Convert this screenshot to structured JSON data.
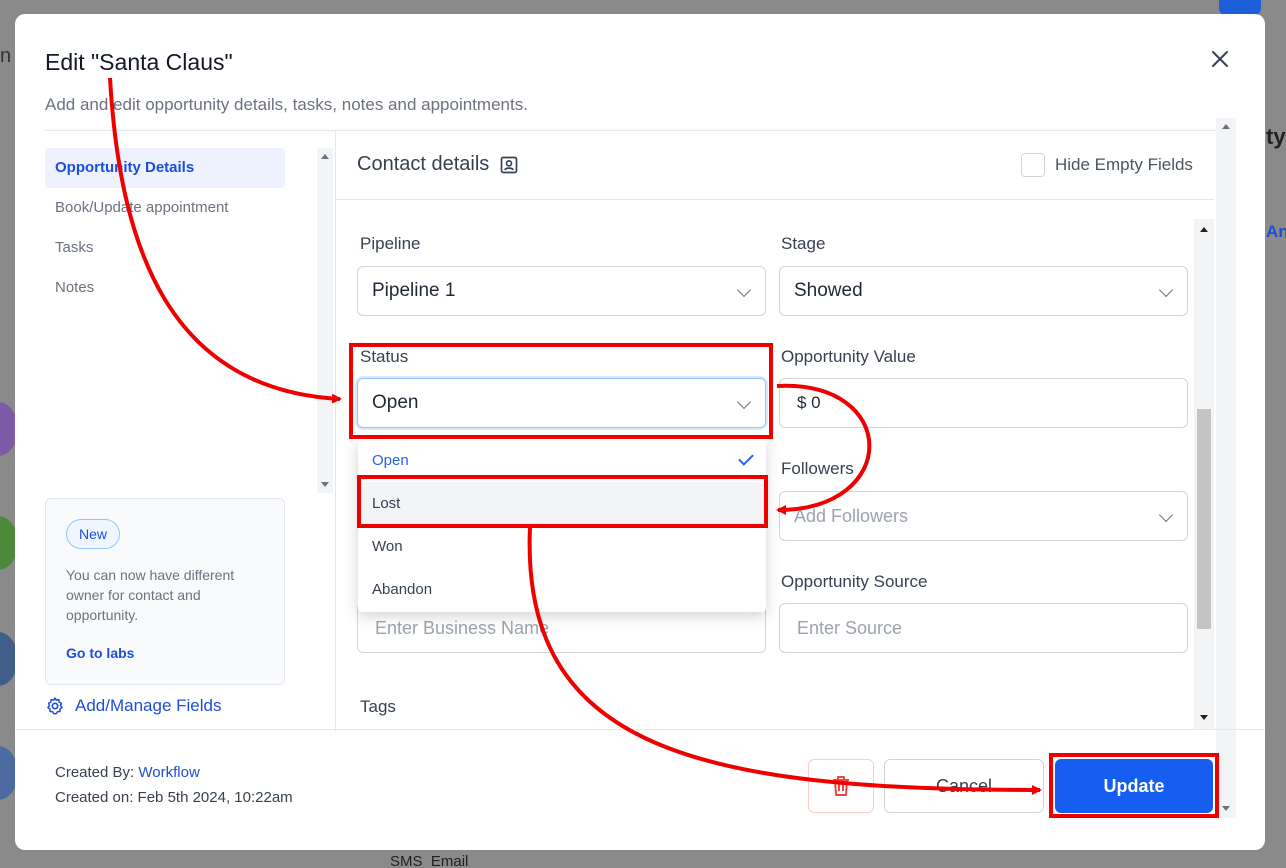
{
  "modal": {
    "title": "Edit \"Santa Claus\"",
    "subtitle": "Add and edit opportunity details, tasks, notes and appointments."
  },
  "sidebar": {
    "items": [
      {
        "label": "Opportunity Details"
      },
      {
        "label": "Book/Update appointment"
      },
      {
        "label": "Tasks"
      },
      {
        "label": "Notes"
      }
    ]
  },
  "info_card": {
    "badge": "New",
    "text": "You can now have different owner for contact and opportunity.",
    "link": "Go to labs"
  },
  "manage_fields": "Add/Manage Fields",
  "contact": {
    "title": "Contact details",
    "hide_empty_label": "Hide Empty Fields"
  },
  "form": {
    "pipeline": {
      "label": "Pipeline",
      "value": "Pipeline 1"
    },
    "stage": {
      "label": "Stage",
      "value": "Showed"
    },
    "status": {
      "label": "Status",
      "value": "Open"
    },
    "opp_value": {
      "label": "Opportunity Value",
      "value": "$ 0"
    },
    "followers": {
      "label": "Followers",
      "placeholder": "Add Followers"
    },
    "business": {
      "placeholder": "Enter Business Name"
    },
    "source": {
      "label": "Opportunity Source",
      "placeholder": "Enter Source"
    },
    "tags": {
      "label": "Tags"
    }
  },
  "status_options": [
    "Open",
    "Lost",
    "Won",
    "Abandon"
  ],
  "footer": {
    "created_by_label": "Created By:",
    "created_by_value": "Workflow",
    "created_on": "Created on: Feb 5th 2024, 10:22am",
    "cancel": "Cancel",
    "update": "Update"
  },
  "background": {
    "sms": "SMS",
    "email": "Email"
  },
  "colors": {
    "accent": "#155eef",
    "annotation": "#ee0000"
  }
}
